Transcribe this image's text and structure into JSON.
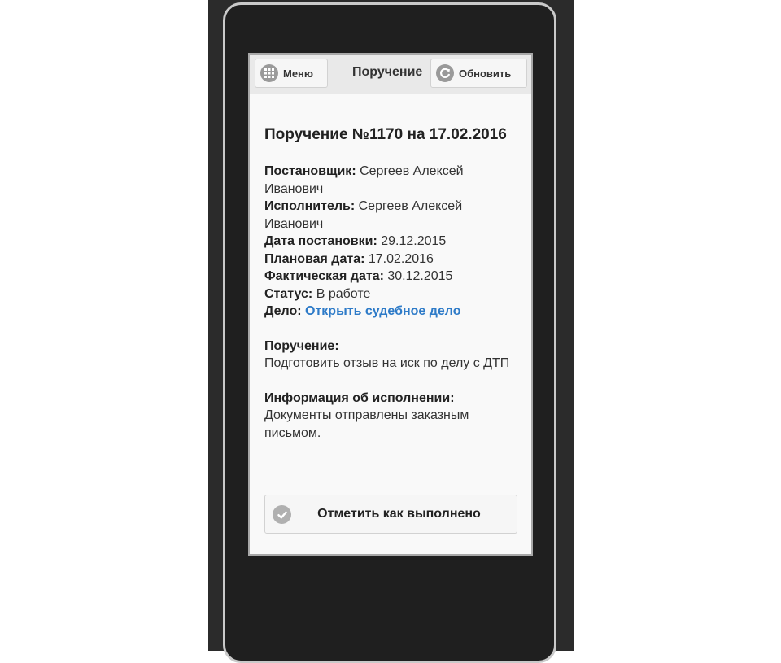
{
  "header": {
    "menu_label": "Меню",
    "title": "Поручение",
    "refresh_label": "Обновить"
  },
  "task": {
    "title": "Поручение №1170 на 17.02.2016",
    "fields": [
      {
        "label": "Постановщик:",
        "value": "Сергеев Алексей Иванович"
      },
      {
        "label": "Исполнитель:",
        "value": "Сергеев Алексей Иванович"
      },
      {
        "label": "Дата постановки:",
        "value": "29.12.2015"
      },
      {
        "label": "Плановая дата:",
        "value": "17.02.2016"
      },
      {
        "label": "Фактическая дата:",
        "value": "30.12.2015"
      },
      {
        "label": "Статус:",
        "value": "В работе"
      }
    ],
    "case_label": "Дело:",
    "case_link": "Открыть судебное дело",
    "assignment_label": "Поручение:",
    "assignment_text": "Подготовить отзыв на иск по делу с ДТП",
    "execution_label": "Информация об исполнении:",
    "execution_text": "Документы отправлены заказным письмом."
  },
  "actions": {
    "mark_done_label": "Отметить как выполнено"
  },
  "icons": {
    "menu": "grid-icon",
    "refresh": "refresh-icon",
    "done": "check-icon"
  },
  "colors": {
    "link": "#2e7bc8",
    "header_bg": "#e9e9e9",
    "device_bg": "#1f1f1f"
  }
}
